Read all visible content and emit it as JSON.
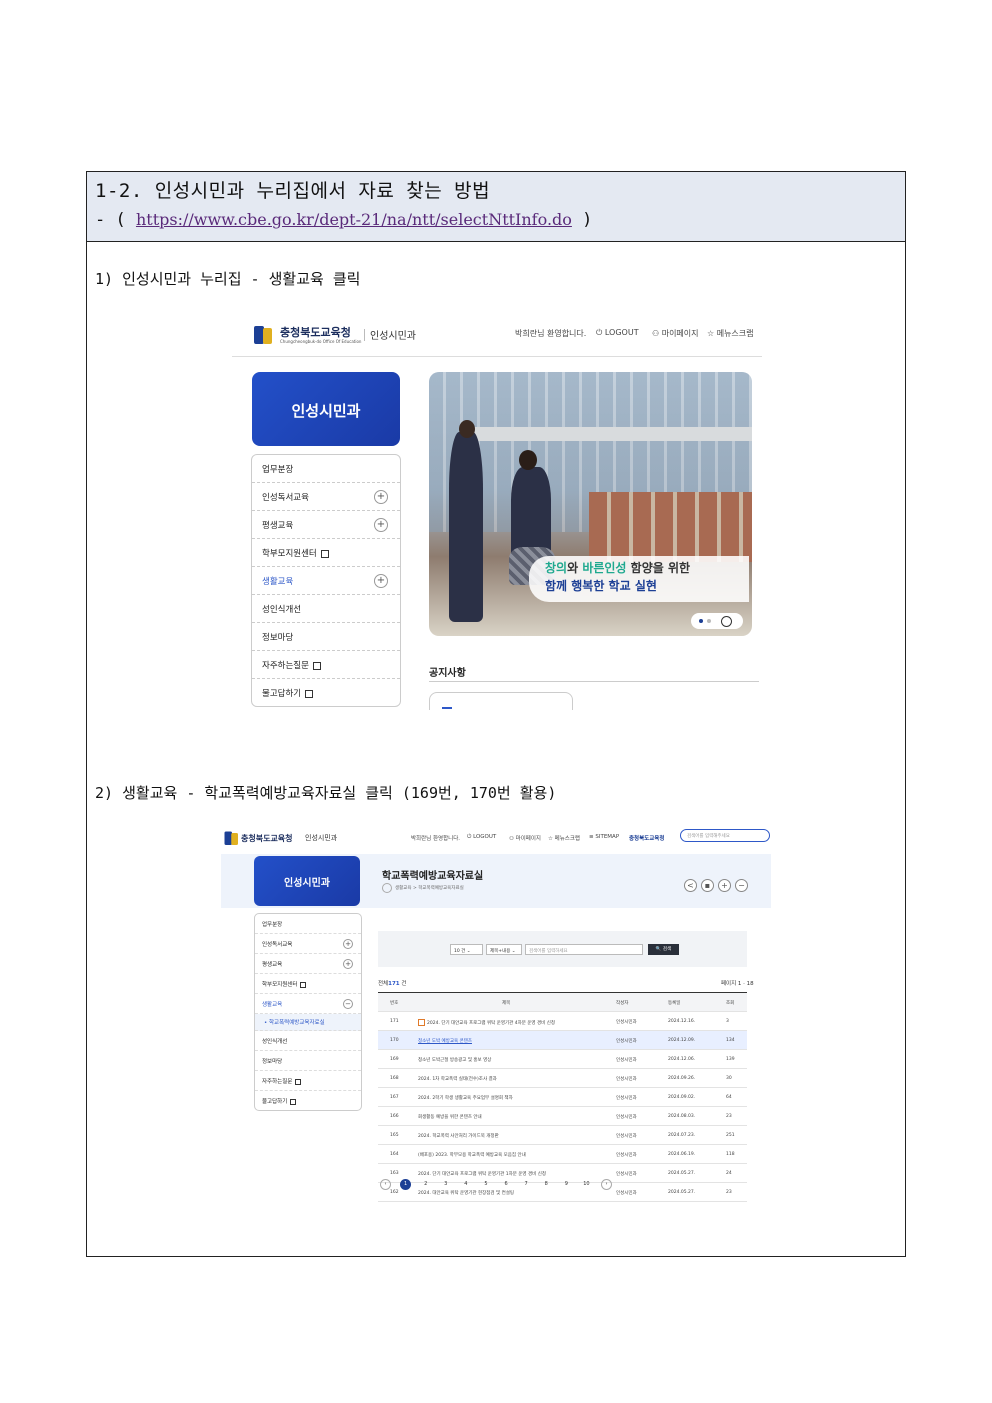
{
  "doc": {
    "title": "1-2. 인성시민과 누리집에서 자료 찾는 방법",
    "url_prefix": "- (",
    "url": "https://www.cbe.go.kr/dept-21/na/ntt/selectNttInfo.do",
    "url_suffix": ")",
    "step1": "1) 인성시민과 누리집 - 생활교육 클릭",
    "step2": "2) 생활교육 - 학교폭력예방교육자료실 클릭 (169번, 170번 활용)"
  },
  "shot1": {
    "logo": "충청북도교육청",
    "logo_sub": "Chungcheongbuk-do Office Of Education",
    "dept": "인성시민과",
    "welcome": "박희란님 환영합니다.",
    "logout": "⏻ LOGOUT",
    "mypage": "⚇ 마이페이지",
    "scrap": "☆ 메뉴스크랩",
    "side_title": "인성시민과",
    "menu": [
      "업무분장",
      "인성독서교육",
      "평생교육",
      "학부모지원센터",
      "생활교육",
      "성인식개선",
      "정보마당",
      "자주하는질문",
      "물고답하기"
    ],
    "banner_hl1": "창의",
    "banner_mid": "와 ",
    "banner_hl2": "바른인성",
    "banner_tail": " 함양을 위한",
    "banner_line2": "함께 행복한 학교 실현",
    "notice": "공지사항"
  },
  "shot2": {
    "logo": "충청북도교육청",
    "dept": "인성시민과",
    "welcome": "박희란님 환영합니다.",
    "logout": "⏻ LOGOUT",
    "mypage": "⚇ 마이페이지",
    "scrap": "☆ 메뉴스크랩",
    "sitemap": "≡ SITEMAP",
    "cbe": "충청북도교육청",
    "search_placeholder": "검색어를 입력해주세요",
    "side_title": "인성시민과",
    "page_title": "학교폭력예방교육자료실",
    "breadcrumb": "생활교육 > 학교폭력예방교육자료실",
    "menu": [
      "업무분장",
      "인성독서교육",
      "평생교육",
      "학부모지원센터",
      "생활교육",
      "• 학교폭력예방교육자료실",
      "성인식개선",
      "정보마당",
      "자주하는질문",
      "물고답하기"
    ],
    "sel_count": "10 건 ⌄",
    "sel_field": "제목+내용 ⌄",
    "search_input": "검색어를 입력하세요",
    "search_btn": "🔍 검색",
    "total_label": "전체",
    "total_value": "171",
    "total_unit": " 건",
    "page_info": "페이지 1 · 18",
    "columns": [
      "번호",
      "제목",
      "작성자",
      "등록일",
      "조회"
    ],
    "rows": [
      {
        "no": "171",
        "title": "2024. 단기 대안교육 프로그램 위탁 운영기관 4차분 운영 경비 신청",
        "author": "인성시민과",
        "date": "2024.12.16.",
        "views": "3"
      },
      {
        "no": "170",
        "title": "청소년 도박 예방교육 콘텐츠",
        "author": "인성시민과",
        "date": "2024.12.09.",
        "views": "134"
      },
      {
        "no": "169",
        "title": "청소년 도박근절 방송광고 및 홍보 영상",
        "author": "인성시민과",
        "date": "2024.12.06.",
        "views": "139"
      },
      {
        "no": "168",
        "title": "2024. 1차 학교폭력 실태(전수)조사 결과",
        "author": "인성시민과",
        "date": "2024.09.26.",
        "views": "30"
      },
      {
        "no": "167",
        "title": "2024. 2학기 학생 생활교육 주요업무 설명회 책자",
        "author": "인성시민과",
        "date": "2024.09.02.",
        "views": "64"
      },
      {
        "no": "166",
        "title": "회생활동 예방을 위한 콘텐츠 안내",
        "author": "인성시민과",
        "date": "2024.08.03.",
        "views": "23"
      },
      {
        "no": "165",
        "title": "2024. 학교폭력 사안처리 가이드북 개정판",
        "author": "인성시민과",
        "date": "2024.07.23.",
        "views": "251"
      },
      {
        "no": "164",
        "title": "(배포용) 2023. 학부모용 학교폭력 예방교육 모음집 안내",
        "author": "인성시민과",
        "date": "2024.06.19.",
        "views": "118"
      },
      {
        "no": "163",
        "title": "2024. 단기 대안교육 프로그램 위탁 운영기관 1차분 운영 경비 신청",
        "author": "인성시민과",
        "date": "2024.05.27.",
        "views": "24"
      },
      {
        "no": "162",
        "title": "2024. 대안교육 위탁 운영기관 현장점검 및 컨설팅",
        "author": "인성시민과",
        "date": "2024.05.27.",
        "views": "23"
      }
    ],
    "pages": [
      "1",
      "2",
      "3",
      "4",
      "5",
      "6",
      "7",
      "8",
      "9",
      "10"
    ],
    "prev": "‹",
    "next": "›"
  }
}
